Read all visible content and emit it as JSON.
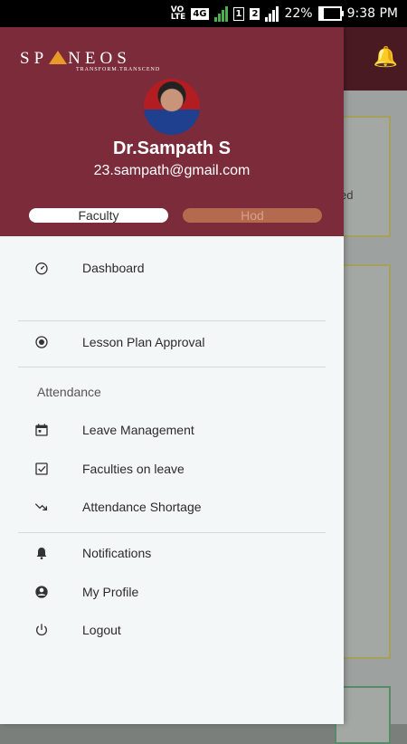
{
  "status_bar": {
    "volte": "VO",
    "lte": "LTE",
    "network": "4G",
    "sim1": "1",
    "sim2": "2",
    "battery": "22%",
    "battery_level": 0.22,
    "time": "9:38 PM"
  },
  "background": {
    "card_text": "ed"
  },
  "header": {
    "brand": "SP NEOS",
    "tagline": "TRANSFORM.TRANSCEND",
    "user_name": "Dr.Sampath S",
    "user_email": "23.sampath@gmail.com",
    "roles": [
      "Faculty",
      "Hod"
    ],
    "selected_role": "Faculty"
  },
  "menu": {
    "dashboard": "Dashboard",
    "lesson_plan_approval": "Lesson Plan Approval",
    "attendance_section": "Attendance",
    "leave_management": "Leave Management",
    "faculties_on_leave": "Faculties on leave",
    "attendance_shortage": "Attendance Shortage",
    "notifications": "Notifications",
    "my_profile": "My Profile",
    "logout": "Logout"
  },
  "icons": {
    "dashboard": "speedometer-icon",
    "lesson_plan_approval": "radio-target-icon",
    "leave_management": "calendar-icon",
    "faculties_on_leave": "checkbox-icon",
    "attendance_shortage": "trending-down-icon",
    "notifications": "bell-icon",
    "my_profile": "account-circle-icon",
    "logout": "power-icon"
  },
  "colors": {
    "header_bg": "#7b2b3a",
    "drawer_bg": "#f3f7f8",
    "logo_accent": "#e79a2a",
    "role_inactive": "#b46a4e"
  }
}
